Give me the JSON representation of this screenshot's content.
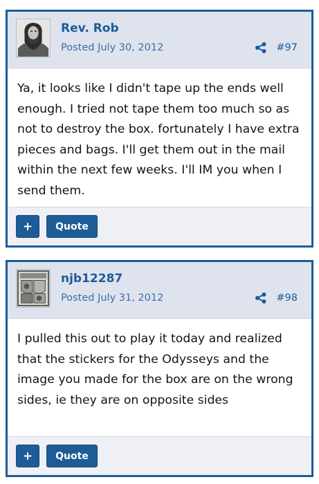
{
  "posts": [
    {
      "username": "Rev. Rob",
      "date": "Posted July 30, 2012",
      "number": "#97",
      "body": "Ya, it looks like I didn't tape up the ends well enough. I tried not tape them too much so as not to destroy the box. fortunately I have extra pieces and bags. I'll get them out in the mail within the next few weeks. I'll IM you when I send them.",
      "avatar_icon": "bearded-man-avatar",
      "plus_label": "+",
      "quote_label": "Quote"
    },
    {
      "username": "njb12287",
      "date": "Posted July 31, 2012",
      "number": "#98",
      "body": "I pulled this out to play it today and realized that the stickers for the Odysseys and the image you made for the box are on the wrong sides, ie they are on opposite sides",
      "avatar_icon": "coat-of-arms-avatar",
      "plus_label": "+",
      "quote_label": "Quote"
    }
  ],
  "colors": {
    "accent": "#1d5c97",
    "header_bg": "#dfe3ee",
    "footer_bg": "#eef0f5",
    "date_text": "#3a6ea5"
  },
  "icons": {
    "share": "share-icon"
  }
}
